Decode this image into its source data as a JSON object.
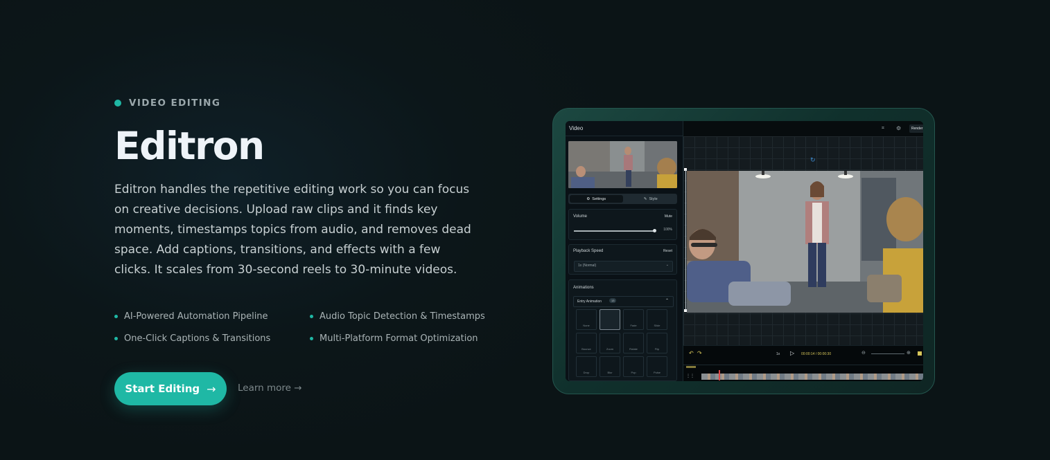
{
  "hero": {
    "eyebrow": "VIDEO EDITING",
    "title": "Editron",
    "description": "Editron handles the repetitive editing work so you can focus on creative decisions. Upload raw clips and it finds key moments, timestamps topics from audio, and removes dead space. Add captions, transitions, and effects with a few clicks. It scales from 30-second reels to 30-minute videos.",
    "features": [
      "AI-Powered Automation Pipeline",
      "Audio Topic Detection & Timestamps",
      "One-Click Captions & Transitions",
      "Multi-Platform Format Optimization"
    ],
    "cta_label": "Start Editing",
    "cta_arrow": "→",
    "learn_more": "Learn more →"
  },
  "colors": {
    "accent": "#1fb8a5",
    "background": "#0c1619"
  },
  "editor": {
    "sidebar_title": "Video",
    "tabs": [
      "Settings",
      "Style"
    ],
    "volume_label": "Volume",
    "mute_label": "Mute",
    "volume_value": "100%",
    "volume_level": 1.0,
    "speed_label": "Playback Speed",
    "reset_label": "Reset",
    "speed_value": "1x (Normal)",
    "animations_label": "Animations",
    "entry_label": "Entry Animation",
    "entry_count": "13",
    "anim_row1": [
      "None",
      "",
      "Fade",
      "Slide"
    ],
    "anim_row2": [
      "Bounce",
      "Zoom",
      "Rotate",
      "Flip"
    ],
    "anim_row3": [
      "Drop",
      "Blur",
      "Pop",
      "Pulse"
    ],
    "render_label": "Render",
    "speed_readout": "1x",
    "time_readout": "00:00:14 / 00:00:30",
    "icons": [
      "undo-icon",
      "redo-icon",
      "play-icon",
      "zoom-out-icon",
      "zoom-in-icon",
      "settings-icon",
      "crop-icon"
    ]
  }
}
